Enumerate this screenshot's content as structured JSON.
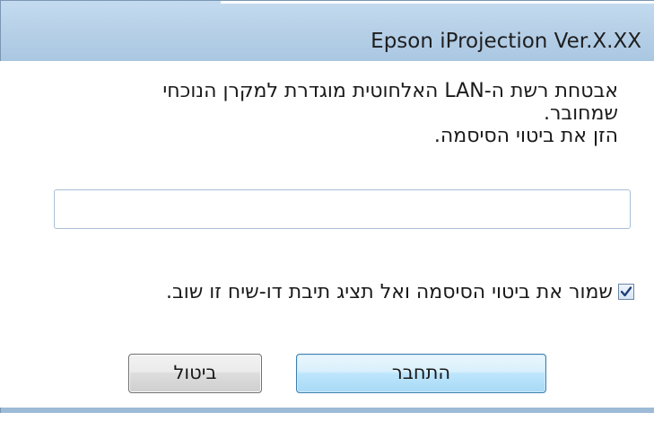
{
  "window": {
    "title": "Epson iProjection Ver.X.XX"
  },
  "message": {
    "lines": [
      "אבטחת רשת ה-LAN האלחוטית מוגדרת למקרן הנוכחי",
      "שמחובר.",
      "הזן את ביטוי הסיסמה."
    ]
  },
  "password": {
    "value": "",
    "placeholder": ""
  },
  "save_option": {
    "checked": true,
    "label": "שמור את ביטוי הסיסמה ואל תציג תיבת דו-שיח זו שוב."
  },
  "buttons": {
    "connect_label": "התחבר",
    "cancel_label": "ביטול"
  },
  "colors": {
    "titlebar": "#b5cfe7",
    "connect_button_border": "#3c7fb1",
    "checkmark": "#1e3f7a"
  },
  "icons": {
    "checkmark": "checkmark-icon"
  }
}
